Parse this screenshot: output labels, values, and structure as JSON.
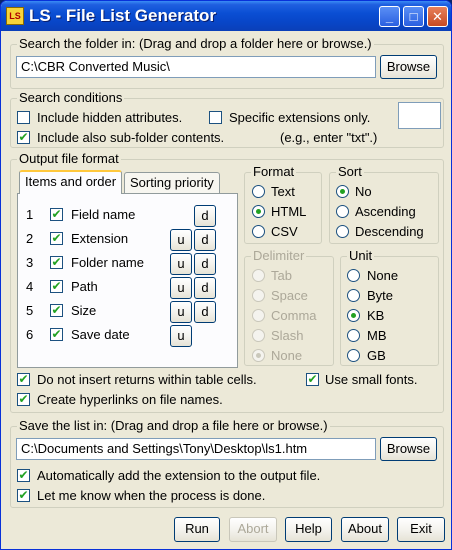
{
  "window": {
    "title": "LS - File List Generator",
    "icon_text": "LS",
    "controls": {
      "minimize": "_",
      "maximize": "□",
      "close": "✕"
    }
  },
  "search_folder": {
    "title": "Search the folder in: (Drag and drop a folder here or browse.)",
    "path": "C:\\CBR Converted Music\\",
    "browse_label": "Browse"
  },
  "search_conditions": {
    "title": "Search conditions",
    "hidden_attrs": {
      "label": "Include hidden attributes.",
      "checked": false
    },
    "specific_ext": {
      "label": "Specific extensions only.",
      "checked": false
    },
    "subfolders": {
      "label": "Include also sub-folder contents.",
      "checked": true
    },
    "ext_hint": "(e.g., enter \"txt\".)",
    "ext_value": ""
  },
  "output_format": {
    "title": "Output file format",
    "tabs": [
      {
        "label": "Items and order",
        "active": true
      },
      {
        "label": "Sorting priority",
        "active": false
      }
    ],
    "items": [
      {
        "num": "1",
        "label": "Field name",
        "checked": true,
        "up": false,
        "down": true
      },
      {
        "num": "2",
        "label": "Extension",
        "checked": true,
        "up": true,
        "down": true
      },
      {
        "num": "3",
        "label": "Folder name",
        "checked": true,
        "up": true,
        "down": true
      },
      {
        "num": "4",
        "label": "Path",
        "checked": true,
        "up": true,
        "down": true
      },
      {
        "num": "5",
        "label": "Size",
        "checked": true,
        "up": true,
        "down": true
      },
      {
        "num": "6",
        "label": "Save date",
        "checked": true,
        "up": true,
        "down": false
      }
    ],
    "up_label": "u",
    "down_label": "d",
    "format": {
      "title": "Format",
      "options": [
        {
          "label": "Text",
          "selected": false
        },
        {
          "label": "HTML",
          "selected": true
        },
        {
          "label": "CSV",
          "selected": false
        }
      ]
    },
    "sort": {
      "title": "Sort",
      "options": [
        {
          "label": "No",
          "selected": true
        },
        {
          "label": "Ascending",
          "selected": false
        },
        {
          "label": "Descending",
          "selected": false
        }
      ]
    },
    "delimiter": {
      "title": "Delimiter",
      "options": [
        {
          "label": "Tab",
          "selected": false
        },
        {
          "label": "Space",
          "selected": false
        },
        {
          "label": "Comma",
          "selected": false
        },
        {
          "label": "Slash",
          "selected": false
        },
        {
          "label": "None",
          "selected": true
        }
      ]
    },
    "unit": {
      "title": "Unit",
      "options": [
        {
          "label": "None",
          "selected": false
        },
        {
          "label": "Byte",
          "selected": false
        },
        {
          "label": "KB",
          "selected": true
        },
        {
          "label": "MB",
          "selected": false
        },
        {
          "label": "GB",
          "selected": false
        }
      ]
    },
    "no_returns": {
      "label": "Do not insert returns within table cells.",
      "checked": true
    },
    "small_fonts": {
      "label": "Use small fonts.",
      "checked": true
    },
    "hyperlinks": {
      "label": "Create hyperlinks on file names.",
      "checked": true
    }
  },
  "save_list": {
    "title": "Save the list in: (Drag and drop a file here or browse.)",
    "path": "C:\\Documents and Settings\\Tony\\Desktop\\ls1.htm",
    "browse_label": "Browse",
    "auto_ext": {
      "label": "Automatically add the extension to the output file.",
      "checked": true
    },
    "notify": {
      "label": "Let me know when the process is done.",
      "checked": true
    }
  },
  "buttons": {
    "run": "Run",
    "abort": "Abort",
    "help": "Help",
    "about": "About",
    "exit": "Exit"
  }
}
